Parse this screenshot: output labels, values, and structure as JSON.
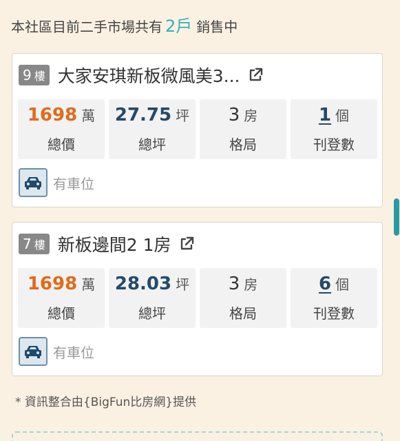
{
  "header": {
    "prefix": "本社區目前二手市場共有",
    "count": "2戶",
    "suffix": "銷售中"
  },
  "listings": [
    {
      "floor": "9",
      "floor_unit": "樓",
      "title": "大家安琪新板微風美3...",
      "price": {
        "value": "1698",
        "unit": "萬",
        "label": "總價"
      },
      "area": {
        "value": "27.75",
        "unit": "坪",
        "label": "總坪"
      },
      "layout": {
        "value": "3",
        "unit": "房",
        "label": "格局"
      },
      "postings": {
        "value": "1",
        "unit": "個",
        "label": "刊登數"
      },
      "parking": "有車位"
    },
    {
      "floor": "7",
      "floor_unit": "樓",
      "title": "新板邊間2 1房",
      "price": {
        "value": "1698",
        "unit": "萬",
        "label": "總價"
      },
      "area": {
        "value": "28.03",
        "unit": "坪",
        "label": "總坪"
      },
      "layout": {
        "value": "3",
        "unit": "房",
        "label": "格局"
      },
      "postings": {
        "value": "6",
        "unit": "個",
        "label": "刊登數"
      },
      "parking": "有車位"
    }
  ],
  "footnote": "* 資訊整合由{BigFun比房網}提供",
  "icons": {
    "external_link": "external-link-icon",
    "car": "car-icon"
  },
  "colors": {
    "accent": "#2ab3b8",
    "price": "#e06b1a",
    "area": "#234a6b",
    "background": "#fbf1e3"
  }
}
